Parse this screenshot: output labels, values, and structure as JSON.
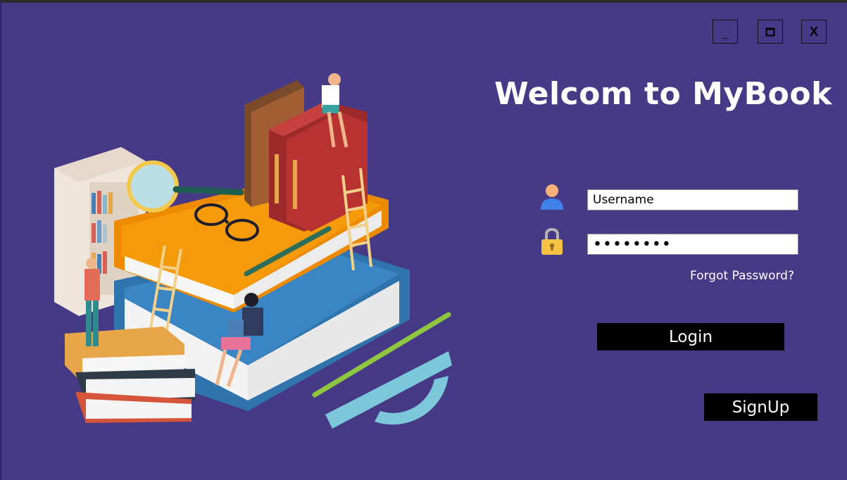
{
  "window": {
    "minimize_label": "_",
    "maximize_icon": "maximize-icon",
    "close_label": "X"
  },
  "header": {
    "title": "Welcom to MyBook"
  },
  "form": {
    "username_value": "Username",
    "password_value": "••••••••",
    "user_icon": "user-icon",
    "lock_icon": "lock-icon",
    "forgot_label": "Forgot Password?",
    "login_label": "Login",
    "signup_label": "SignUp"
  },
  "colors": {
    "background": "#463a87",
    "button_bg": "#000000",
    "text": "#ffffff"
  }
}
